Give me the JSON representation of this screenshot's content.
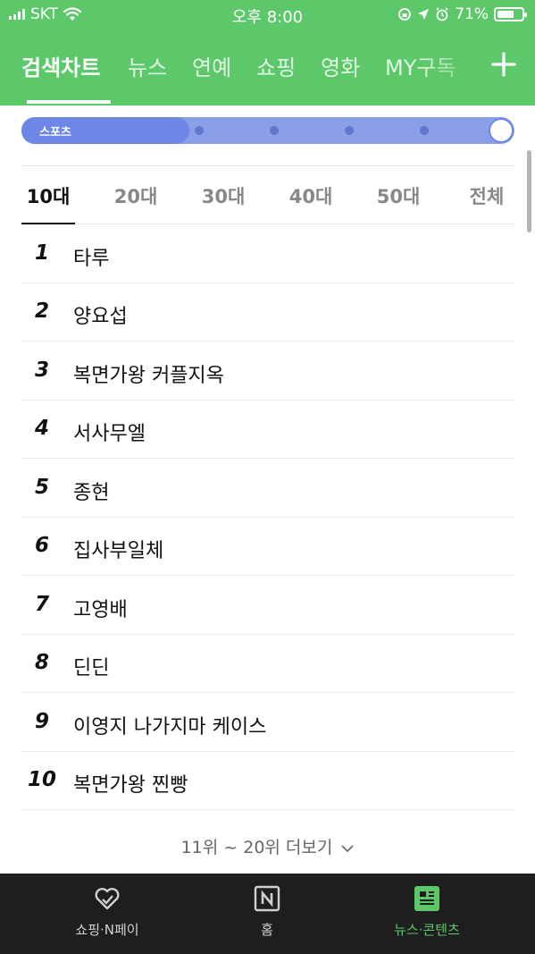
{
  "status_bar": {
    "carrier": "SKT",
    "time": "오후 8:00",
    "battery_text": "71%",
    "battery_level": 0.71,
    "icons": [
      "signal-icon",
      "wifi-icon",
      "rotation-lock-icon",
      "location-icon",
      "alarm-icon",
      "battery-icon"
    ]
  },
  "nav_tabs": [
    {
      "label": "검색차트",
      "active": true
    },
    {
      "label": "뉴스",
      "active": false
    },
    {
      "label": "연예",
      "active": false
    },
    {
      "label": "쇼핑",
      "active": false
    },
    {
      "label": "영화",
      "active": false
    },
    {
      "label": "MY구독",
      "active": false
    }
  ],
  "add_button_icon": "plus-icon",
  "slider": {
    "label": "스포츠",
    "level": 1.0
  },
  "age_tabs": [
    {
      "label": "10대",
      "active": true
    },
    {
      "label": "20대",
      "active": false
    },
    {
      "label": "30대",
      "active": false
    },
    {
      "label": "40대",
      "active": false
    },
    {
      "label": "50대",
      "active": false
    },
    {
      "label": "전체",
      "active": false
    }
  ],
  "ranking": [
    {
      "rank": "1",
      "term": "타루"
    },
    {
      "rank": "2",
      "term": "양요섭"
    },
    {
      "rank": "3",
      "term": "복면가왕 커플지옥"
    },
    {
      "rank": "4",
      "term": "서사무엘"
    },
    {
      "rank": "5",
      "term": "종현"
    },
    {
      "rank": "6",
      "term": "집사부일체"
    },
    {
      "rank": "7",
      "term": "고영배"
    },
    {
      "rank": "8",
      "term": "딘딘"
    },
    {
      "rank": "9",
      "term": "이영지 나가지마 케이스"
    },
    {
      "rank": "10",
      "term": "복면가왕 찐빵"
    }
  ],
  "more_link": "11위 ~ 20위 더보기",
  "bottom_nav": [
    {
      "label": "쇼핑·N페이",
      "icon": "heart-check-icon",
      "active": false
    },
    {
      "label": "홈",
      "icon": "naver-n-icon",
      "active": false
    },
    {
      "label": "뉴스·콘텐츠",
      "icon": "news-icon",
      "active": true
    }
  ],
  "colors": {
    "header_green": "#5cc86a",
    "slider_blue": "#6e87e6",
    "nav_background": "#1e1e1e"
  }
}
